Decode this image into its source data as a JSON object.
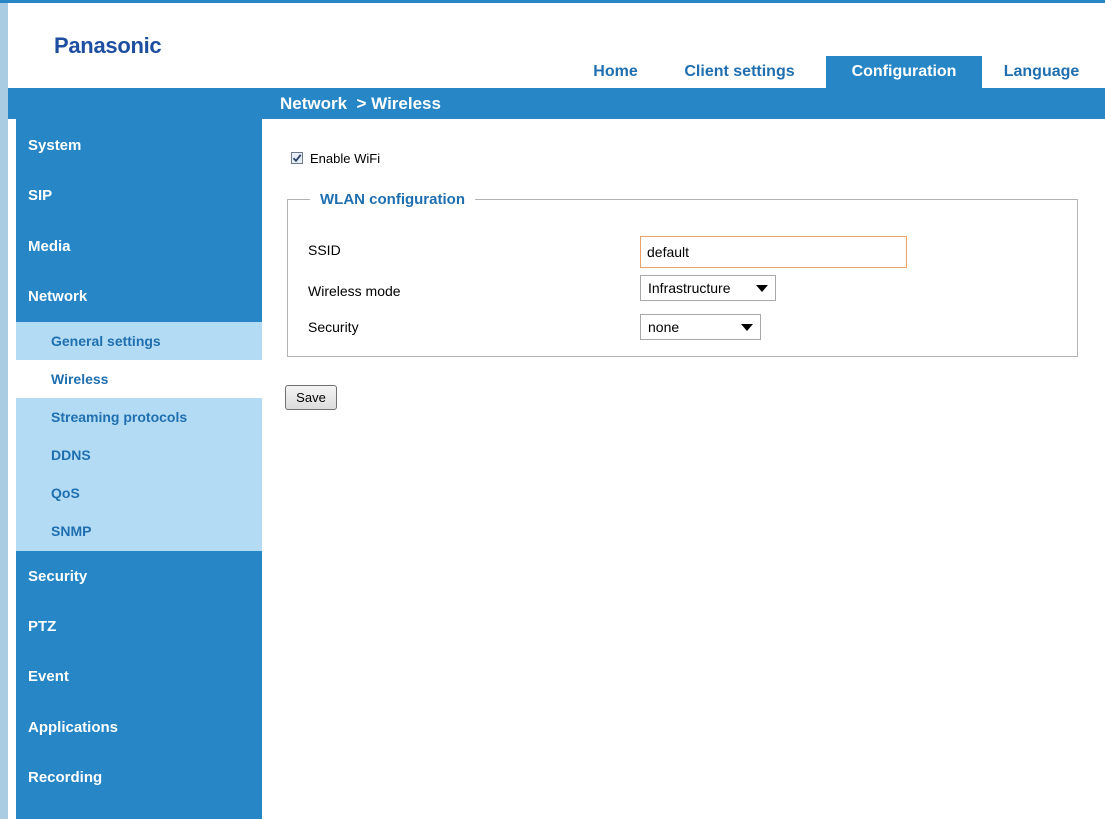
{
  "brand": {
    "logo_text": "Panasonic"
  },
  "topnav": {
    "items": [
      {
        "label": "Home",
        "active": false
      },
      {
        "label": "Client settings",
        "active": false
      },
      {
        "label": "Configuration",
        "active": true
      },
      {
        "label": "Language",
        "active": false
      }
    ]
  },
  "breadcrumb": {
    "text": "Network  > Wireless"
  },
  "sidebar": {
    "items": [
      {
        "label": "System"
      },
      {
        "label": "SIP"
      },
      {
        "label": "Media"
      },
      {
        "label": "Network"
      },
      {
        "label": "Security"
      },
      {
        "label": "PTZ"
      },
      {
        "label": "Event"
      },
      {
        "label": "Applications"
      },
      {
        "label": "Recording"
      }
    ],
    "network_submenu": [
      {
        "label": "General settings",
        "active": false
      },
      {
        "label": "Wireless",
        "active": true
      },
      {
        "label": "Streaming protocols",
        "active": false
      },
      {
        "label": "DDNS",
        "active": false
      },
      {
        "label": "QoS",
        "active": false
      },
      {
        "label": "SNMP",
        "active": false
      }
    ]
  },
  "wifi": {
    "enable_label": "Enable WiFi",
    "enabled": true
  },
  "wlan": {
    "legend": "WLAN configuration",
    "ssid_label": "SSID",
    "ssid_value": "default",
    "mode_label": "Wireless mode",
    "mode_value": "Infrastructure",
    "security_label": "Security",
    "security_value": "none"
  },
  "actions": {
    "save_label": "Save"
  },
  "colors": {
    "primary_blue": "#2686c6",
    "submenu_bg": "#b3dcf4",
    "link_blue": "#1f6fb0",
    "logo_blue": "#1d4e9f",
    "ssid_border": "#e8a26a"
  }
}
